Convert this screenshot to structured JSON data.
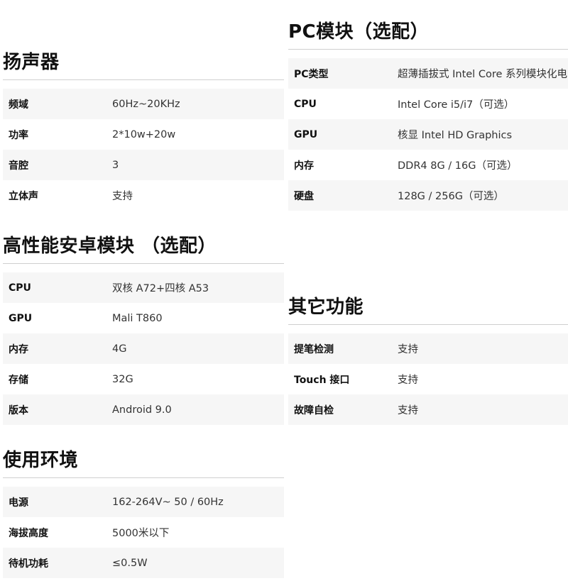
{
  "sections": {
    "speaker": {
      "title": "扬声器",
      "rows": [
        {
          "label": "频域",
          "value": "60Hz~20KHz"
        },
        {
          "label": "功率",
          "value": "2*10w+20w"
        },
        {
          "label": "音腔",
          "value": "3"
        },
        {
          "label": "立体声",
          "value": "支持"
        }
      ]
    },
    "android": {
      "title": "高性能安卓模块 （选配）",
      "rows": [
        {
          "label": "CPU",
          "value": "双核 A72+四核 A53"
        },
        {
          "label": "GPU",
          "value": "Mali T860"
        },
        {
          "label": "内存",
          "value": "4G"
        },
        {
          "label": "存储",
          "value": "32G"
        },
        {
          "label": "版本",
          "value": "Android 9.0"
        }
      ]
    },
    "environment": {
      "title": "使用环境",
      "rows": [
        {
          "label": "电源",
          "value": "162-264V~ 50 / 60Hz"
        },
        {
          "label": "海拔高度",
          "value": "5000米以下"
        },
        {
          "label": "待机功耗",
          "value": "≤0.5W"
        }
      ]
    },
    "pc": {
      "title": "PC模块（选配）",
      "rows": [
        {
          "label": "PC类型",
          "value": "超薄插拔式 Intel Core 系列模块化电"
        },
        {
          "label": "CPU",
          "value": "Intel Core i5/i7（可选）"
        },
        {
          "label": "GPU",
          "value": "核显 Intel HD Graphics"
        },
        {
          "label": "内存",
          "value": "DDR4 8G / 16G（可选）"
        },
        {
          "label": "硬盘",
          "value": "128G / 256G（可选）"
        }
      ]
    },
    "other": {
      "title": "其它功能",
      "rows": [
        {
          "label": "提笔检测",
          "value": "支持"
        },
        {
          "label": "Touch 接口",
          "value": "支持"
        },
        {
          "label": "故障自检",
          "value": "支持"
        }
      ]
    }
  }
}
